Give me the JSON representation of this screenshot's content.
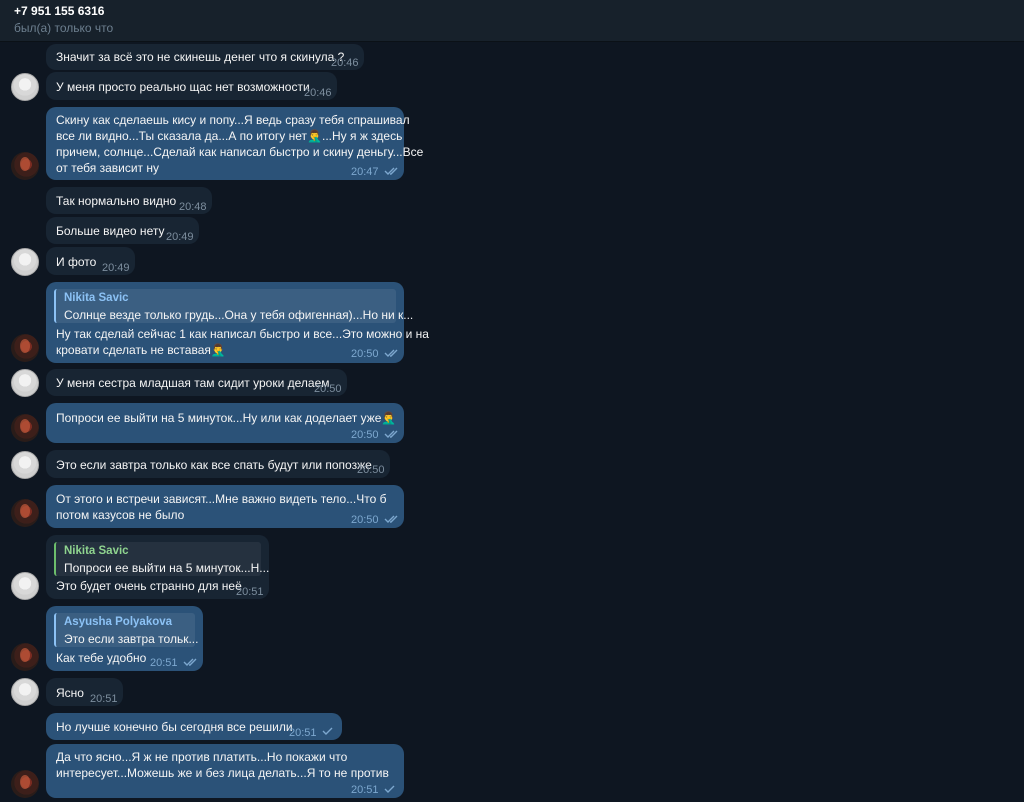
{
  "header": {
    "title": "+7 951 155 6316",
    "status": "был(а) только что"
  },
  "messages": [
    {
      "text": [
        "Значит за всё это не скинешь денег что я скинула ?"
      ],
      "time": "20:46"
    },
    {
      "text": [
        "У меня просто реально щас нет возможности"
      ],
      "time": "20:46"
    },
    {
      "text": [
        "Скину как сделаешь кису и попу...Я ведь сразу тебя спрашивал",
        "все ли видно...Ты сказала да...А по итогу нет🤦‍♂️...Ну я ж здесь",
        "причем, солнце...Сделай как написал быстро и скину деньгу...Все",
        "от тебя зависит ну"
      ],
      "time": "20:47"
    },
    {
      "text": [
        "Так нормально видно"
      ],
      "time": "20:48"
    },
    {
      "text": [
        "Больше видео нету"
      ],
      "time": "20:49"
    },
    {
      "text": [
        "И фото"
      ],
      "time": "20:49"
    },
    {
      "reply": {
        "name": "Nikita Savic",
        "text": "Солнце везде только грудь...Она у тебя офигенная)...Но ни к..."
      },
      "text": [
        "Ну так сделай сейчас 1 как написал быстро и все...Это можно и на",
        "кровати сделать не вставая🤦‍♂️"
      ],
      "time": "20:50"
    },
    {
      "text": [
        "У меня сестра младшая там сидит уроки делаем"
      ],
      "time": "20:50"
    },
    {
      "text": [
        "Попроси ее выйти на 5 минуток...Ну или как доделает уже🤦‍♂️"
      ],
      "time": "20:50"
    },
    {
      "text": [
        "Это если завтра только как все спать будут или попозже"
      ],
      "time": "20:50"
    },
    {
      "text": [
        "От этого и встречи зависят...Мне важно видеть тело...Что б",
        "потом казусов не было"
      ],
      "time": "20:50"
    },
    {
      "reply": {
        "name": "Nikita Savic",
        "text": "Попроси ее выйти на 5 минуток...Н..."
      },
      "text": [
        "Это будет очень странно для неё"
      ],
      "time": "20:51"
    },
    {
      "reply": {
        "name": "Asyusha Polyakova",
        "text": "Это если завтра тольк..."
      },
      "text": [
        "Как тебе удобно"
      ],
      "time": "20:51"
    },
    {
      "text": [
        "Ясно"
      ],
      "time": "20:51"
    },
    {
      "text": [
        "Но лучше конечно бы сегодня все решили"
      ],
      "time": "20:51"
    },
    {
      "text": [
        "Да что ясно...Я ж не против платить...Но покажи что",
        "интересует...Можешь же и без лица делать...Я то не против"
      ],
      "time": "20:51"
    }
  ]
}
